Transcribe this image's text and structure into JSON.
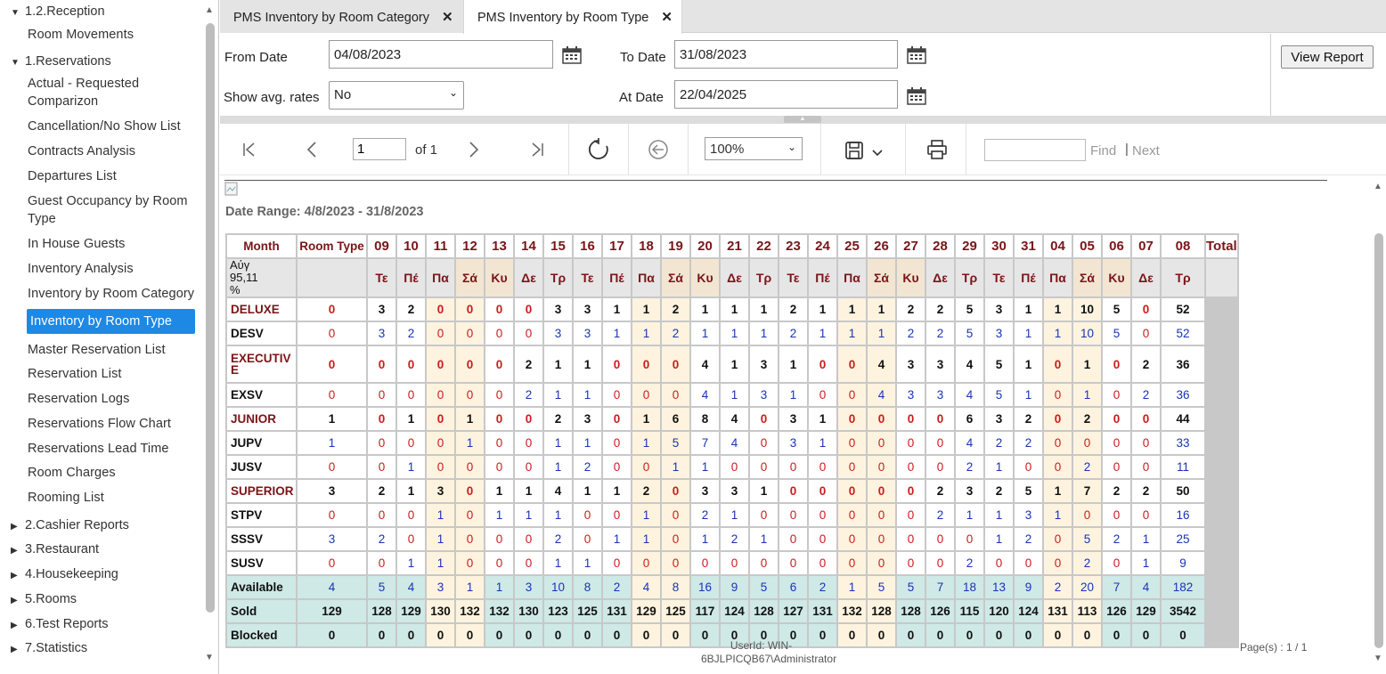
{
  "sidebar": {
    "groups_top": [
      {
        "label": "1.2.Reception",
        "expanded": true
      },
      {
        "label": "1.Reservations",
        "expanded": true
      }
    ],
    "reception_items": [
      "Room Movements"
    ],
    "reservation_items": [
      "Actual - Requested Comparizon",
      "Cancellation/No Show List",
      "Contracts Analysis",
      "Departures List",
      "Guest Occupancy by Room Type",
      "In House Guests",
      "Inventory Analysis",
      "Inventory by Room Category",
      "Inventory by Room Type",
      "Master Reservation List",
      "Reservation List",
      "Reservation Logs",
      "Reservations Flow Chart",
      "Reservations Lead Time",
      "Room Charges",
      "Rooming List"
    ],
    "active_item": "Inventory by Room Type",
    "groups_bottom": [
      "2.Cashier Reports",
      "3.Restaurant",
      "4.Housekeeping",
      "5.Rooms",
      "6.Test Reports",
      "7.Statistics"
    ]
  },
  "tabs": [
    {
      "label": "PMS Inventory by Room Category",
      "close": "✕"
    },
    {
      "label": "PMS Inventory by Room Type",
      "close": "✕",
      "active": true
    }
  ],
  "params": {
    "from_date_label": "From Date",
    "from_date": "04/08/2023",
    "to_date_label": "To Date",
    "to_date": "31/08/2023",
    "show_avg_label": "Show avg. rates",
    "show_avg_value": "No",
    "at_date_label": "At Date",
    "at_date": "22/04/2025",
    "view_report": "View Report"
  },
  "toolbar": {
    "page": "1",
    "of_label": "of 1",
    "zoom": "100%",
    "find_label": "Find",
    "next_label": "Next",
    "separator": "|"
  },
  "report": {
    "date_range": "Date Range: 4/8/2023 - 31/8/2023",
    "headers": {
      "month": "Month",
      "room_type": "Room Type",
      "total": "Total"
    },
    "days": [
      "09",
      "10",
      "11",
      "12",
      "13",
      "14",
      "15",
      "16",
      "17",
      "18",
      "19",
      "20",
      "21",
      "22",
      "23",
      "24",
      "25",
      "26",
      "27",
      "28",
      "29",
      "30",
      "31",
      "04",
      "05",
      "06",
      "07",
      "08"
    ],
    "weekdays": [
      "Τε",
      "Πέ",
      "Πα",
      "Σά",
      "Κυ",
      "Δε",
      "Τρ",
      "Τε",
      "Πέ",
      "Πα",
      "Σά",
      "Κυ",
      "Δε",
      "Τρ",
      "Τε",
      "Πέ",
      "Πα",
      "Σά",
      "Κυ",
      "Δε",
      "Τρ",
      "Τε",
      "Πέ",
      "Πα",
      "Σά",
      "Κυ",
      "Δε",
      "Τρ"
    ],
    "weekend_idx": [
      3,
      4,
      10,
      11,
      17,
      18,
      24,
      25
    ],
    "month_label": [
      "Αύγ",
      "95,11",
      "%"
    ],
    "rows": [
      {
        "name": "DELUXE",
        "kind": "cat",
        "values": [
          0,
          3,
          2,
          0,
          0,
          0,
          0,
          3,
          3,
          1,
          1,
          2,
          1,
          1,
          1,
          2,
          1,
          1,
          1,
          2,
          2,
          5,
          3,
          1,
          1,
          10,
          5,
          0
        ],
        "total": 52
      },
      {
        "name": "DESV",
        "kind": "sub",
        "values": [
          0,
          3,
          2,
          0,
          0,
          0,
          0,
          3,
          3,
          1,
          1,
          2,
          1,
          1,
          1,
          2,
          1,
          1,
          1,
          2,
          2,
          5,
          3,
          1,
          1,
          10,
          5,
          0
        ],
        "total": 52
      },
      {
        "name": "EXECUTIVE",
        "kind": "cat",
        "values": [
          0,
          0,
          0,
          0,
          0,
          0,
          2,
          1,
          1,
          0,
          0,
          0,
          4,
          1,
          3,
          1,
          0,
          0,
          4,
          3,
          3,
          4,
          5,
          1,
          0,
          1,
          0,
          2
        ],
        "total": 36
      },
      {
        "name": "EXSV",
        "kind": "sub",
        "values": [
          0,
          0,
          0,
          0,
          0,
          0,
          2,
          1,
          1,
          0,
          0,
          0,
          4,
          1,
          3,
          1,
          0,
          0,
          4,
          3,
          3,
          4,
          5,
          1,
          0,
          1,
          0,
          2
        ],
        "total": 36
      },
      {
        "name": "JUNIOR",
        "kind": "cat",
        "values": [
          1,
          0,
          1,
          0,
          1,
          0,
          0,
          2,
          3,
          0,
          1,
          6,
          8,
          4,
          0,
          3,
          1,
          0,
          0,
          0,
          0,
          6,
          3,
          2,
          0,
          2,
          0,
          0
        ],
        "total": 44
      },
      {
        "name": "JUPV",
        "kind": "sub",
        "values": [
          1,
          0,
          0,
          0,
          1,
          0,
          0,
          1,
          1,
          0,
          1,
          5,
          7,
          4,
          0,
          3,
          1,
          0,
          0,
          0,
          0,
          4,
          2,
          2,
          0,
          0,
          0,
          0
        ],
        "total": 33
      },
      {
        "name": "JUSV",
        "kind": "sub",
        "values": [
          0,
          0,
          1,
          0,
          0,
          0,
          0,
          1,
          2,
          0,
          0,
          1,
          1,
          0,
          0,
          0,
          0,
          0,
          0,
          0,
          0,
          2,
          1,
          0,
          0,
          2,
          0,
          0
        ],
        "total": 11
      },
      {
        "name": "SUPERIOR",
        "kind": "cat",
        "values": [
          3,
          2,
          1,
          3,
          0,
          1,
          1,
          4,
          1,
          1,
          2,
          0,
          3,
          3,
          1,
          0,
          0,
          0,
          0,
          0,
          2,
          3,
          2,
          5,
          1,
          7,
          2,
          2
        ],
        "total": 50
      },
      {
        "name": "STPV",
        "kind": "sub",
        "values": [
          0,
          0,
          0,
          1,
          0,
          1,
          1,
          1,
          0,
          0,
          1,
          0,
          2,
          1,
          0,
          0,
          0,
          0,
          0,
          0,
          2,
          1,
          1,
          3,
          1,
          0,
          0,
          0
        ],
        "total": 16
      },
      {
        "name": "SSSV",
        "kind": "sub",
        "values": [
          3,
          2,
          0,
          1,
          0,
          0,
          0,
          2,
          0,
          1,
          1,
          0,
          1,
          2,
          1,
          0,
          0,
          0,
          0,
          0,
          0,
          0,
          1,
          2,
          0,
          5,
          2,
          1
        ],
        "total": 25
      },
      {
        "name": "SUSV",
        "kind": "sub",
        "values": [
          0,
          0,
          1,
          1,
          0,
          0,
          0,
          1,
          1,
          0,
          0,
          0,
          0,
          0,
          0,
          0,
          0,
          0,
          0,
          0,
          0,
          2,
          0,
          0,
          0,
          2,
          0,
          1
        ],
        "total": 9
      }
    ],
    "footer": [
      {
        "name": "Available",
        "kind": "avail",
        "values": [
          4,
          5,
          4,
          3,
          1,
          1,
          3,
          10,
          8,
          2,
          4,
          8,
          16,
          9,
          5,
          6,
          2,
          1,
          5,
          5,
          7,
          18,
          13,
          9,
          2,
          20,
          7,
          4
        ],
        "total": 182
      },
      {
        "name": "Sold",
        "kind": "sold",
        "values": [
          129,
          128,
          129,
          130,
          132,
          132,
          130,
          123,
          125,
          131,
          129,
          125,
          117,
          124,
          128,
          127,
          131,
          132,
          128,
          128,
          126,
          115,
          120,
          124,
          131,
          113,
          126,
          129
        ],
        "total": 3542
      },
      {
        "name": "Blocked",
        "kind": "blocked",
        "values": [
          0,
          0,
          0,
          0,
          0,
          0,
          0,
          0,
          0,
          0,
          0,
          0,
          0,
          0,
          0,
          0,
          0,
          0,
          0,
          0,
          0,
          0,
          0,
          0,
          0,
          0,
          0,
          0
        ],
        "total": 0
      }
    ],
    "user_id": "UserId: WIN-6BJLPICQB67\\Administrator",
    "pages": "Page(s) : 1 / 1"
  }
}
